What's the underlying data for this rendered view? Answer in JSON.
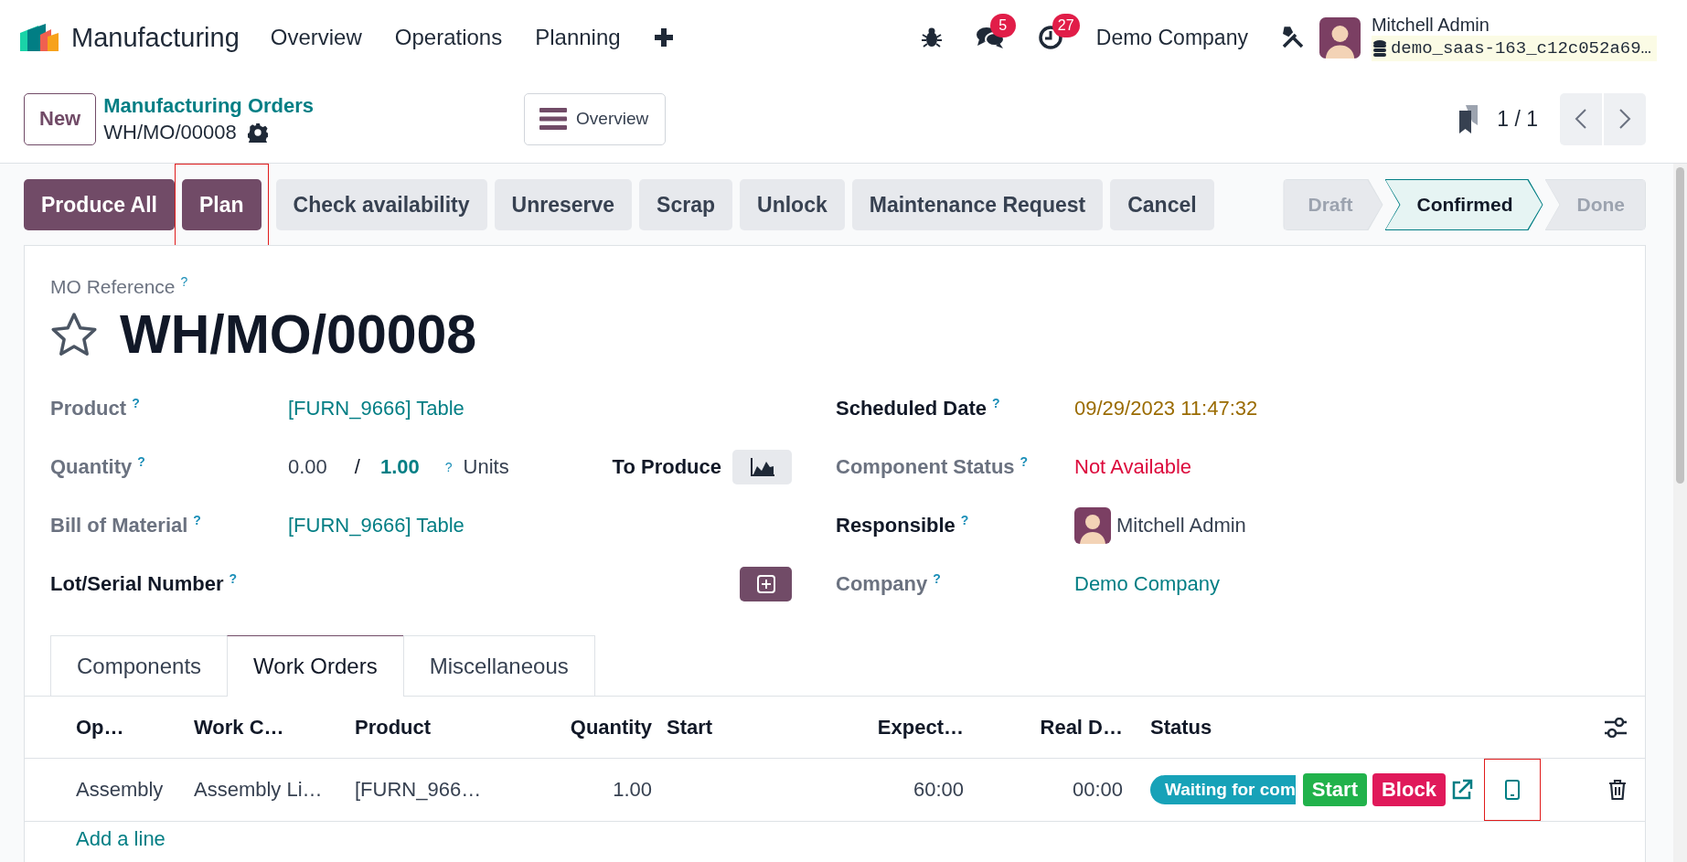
{
  "navbar": {
    "app_name": "Manufacturing",
    "menu": [
      {
        "label": "Overview"
      },
      {
        "label": "Operations"
      },
      {
        "label": "Planning"
      }
    ],
    "messages_badge": "5",
    "activities_badge": "27",
    "company": "Demo Company",
    "user_name": "Mitchell Admin",
    "database": "demo_saas-163_c12c052a69…"
  },
  "control_panel": {
    "new_button": "New",
    "breadcrumb": "Manufacturing Orders",
    "record": "WH/MO/00008",
    "view_button": "Overview",
    "pager": "1 / 1"
  },
  "actions": [
    {
      "label": "Produce All",
      "kind": "primary",
      "highlighted": false
    },
    {
      "label": "Plan",
      "kind": "primary",
      "highlighted": true
    },
    {
      "label": "Check availability",
      "kind": "secondary",
      "highlighted": false
    },
    {
      "label": "Unreserve",
      "kind": "secondary",
      "highlighted": false
    },
    {
      "label": "Scrap",
      "kind": "secondary",
      "highlighted": false
    },
    {
      "label": "Unlock",
      "kind": "secondary",
      "highlighted": false
    },
    {
      "label": "Maintenance Request",
      "kind": "secondary",
      "highlighted": false
    },
    {
      "label": "Cancel",
      "kind": "secondary",
      "highlighted": false
    }
  ],
  "statusbar": [
    {
      "label": "Draft",
      "selected": false
    },
    {
      "label": "Confirmed",
      "selected": true
    },
    {
      "label": "Done",
      "selected": false
    }
  ],
  "form": {
    "reference_label": "MO Reference",
    "reference_help": "?",
    "title": "WH/MO/00008",
    "starred": false,
    "left_fields": [
      {
        "kind": "link",
        "label": "Product",
        "help": "?",
        "required": false,
        "value": "[FURN_9666] Table"
      },
      {
        "kind": "quantity",
        "label": "Quantity",
        "help": "?",
        "required": false,
        "produced": "0.00",
        "separator": "/",
        "planned": "1.00",
        "value_help": "?",
        "uom": "Units",
        "extra_label": "To Produce"
      },
      {
        "kind": "link",
        "label": "Bill of Material",
        "help": "?",
        "required": false,
        "value": "[FURN_9666] Table"
      },
      {
        "kind": "add",
        "label": "Lot/Serial Number",
        "help": "?",
        "required": true
      }
    ],
    "right_fields": [
      {
        "kind": "date",
        "label": "Scheduled Date",
        "help": "?",
        "required": true,
        "value": "09/29/2023 11:47:32"
      },
      {
        "kind": "danger",
        "label": "Component Status",
        "help": "?",
        "required": false,
        "value": "Not Available"
      },
      {
        "kind": "user",
        "label": "Responsible",
        "help": "?",
        "required": true,
        "value": "Mitchell Admin"
      },
      {
        "kind": "link",
        "label": "Company",
        "help": "?",
        "required": false,
        "value": "Demo Company"
      }
    ]
  },
  "tabs": [
    {
      "label": "Components",
      "selected": false
    },
    {
      "label": "Work Orders",
      "selected": true
    },
    {
      "label": "Miscellaneous",
      "selected": false
    }
  ],
  "table": {
    "columns": [
      "Op…",
      "Work C…",
      "Product",
      "Quantity",
      "Start",
      "Expect…",
      "Real D…",
      "Status"
    ],
    "rows": [
      {
        "operation": "Assembly",
        "work_center": "Assembly Li…",
        "product": "[FURN_966…",
        "quantity": "1.00",
        "expected": "60:00",
        "real": "00:00",
        "status": "Waiting for com",
        "buttons": [
          {
            "label": "Start",
            "kind": "success"
          },
          {
            "label": "Block",
            "kind": "danger"
          }
        ],
        "tablet_highlighted": true
      }
    ],
    "add_line": "Add a line"
  }
}
